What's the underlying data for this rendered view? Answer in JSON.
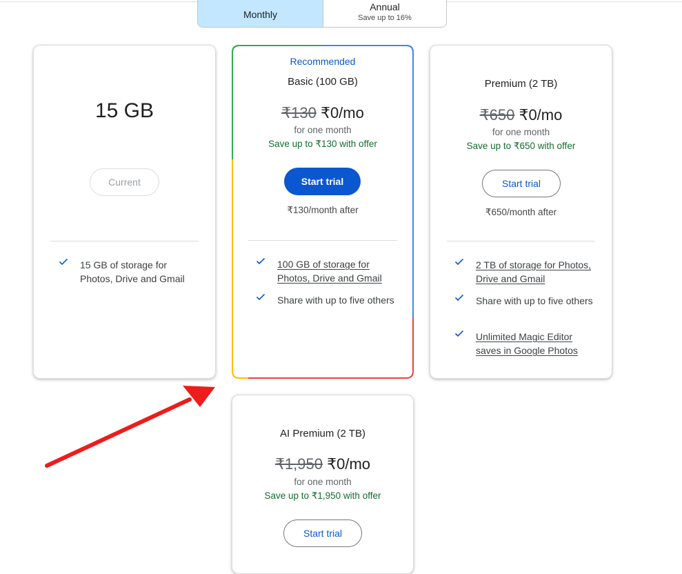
{
  "billing": {
    "monthly_label": "Monthly",
    "annual_label": "Annual",
    "annual_note": "Save up to 16%"
  },
  "plans": {
    "free": {
      "storage": "15 GB",
      "button_label": "Current",
      "features": [
        "15 GB of storage for Photos, Drive and Gmail"
      ]
    },
    "basic": {
      "recommended_label": "Recommended",
      "name": "Basic (100 GB)",
      "old_price": "₹130",
      "new_price": "₹0/mo",
      "period": "for one month",
      "save_note": "Save up to ₹130 with offer",
      "button_label": "Start trial",
      "after_price": "₹130/month after",
      "features": [
        "100 GB of storage for Photos, Drive and Gmail",
        "Share with up to five others"
      ]
    },
    "premium": {
      "name": "Premium (2 TB)",
      "old_price": "₹650",
      "new_price": "₹0/mo",
      "period": "for one month",
      "save_note": "Save up to ₹650 with offer",
      "button_label": "Start trial",
      "after_price": "₹650/month after",
      "features": [
        "2 TB of storage for Photos, Drive and Gmail",
        "Share with up to five others",
        "Unlimited Magic Editor saves in Google Photos"
      ]
    },
    "ai_premium": {
      "name": "AI Premium (2 TB)",
      "old_price": "₹1,950",
      "new_price": "₹0/mo",
      "period": "for one month",
      "save_note": "Save up to ₹1,950 with offer",
      "button_label": "Start trial"
    }
  },
  "colors": {
    "accent_blue": "#0b57d0",
    "toggle_active": "#c2e7ff",
    "save_green": "#146c2e",
    "annotation_arrow": "#ee1c1c",
    "google_blue": "#4285f4",
    "google_red": "#ea4335",
    "google_yellow": "#fbbc04",
    "google_green": "#34a853"
  },
  "icons": {
    "feature_check": "check-icon"
  }
}
